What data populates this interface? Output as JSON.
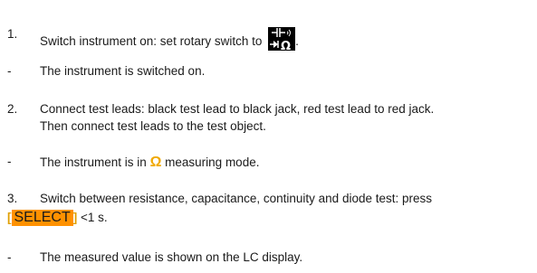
{
  "steps": [
    {
      "marker": "1.",
      "text": "Switch instrument on: set rotary switch to",
      "suffix": "."
    },
    {
      "marker": "-",
      "text": "The instrument is switched on."
    },
    {
      "marker": "2.",
      "line1": "Connect test leads: black test lead to black jack, red test lead to red jack.",
      "line2": "Then connect test leads to the test object."
    },
    {
      "marker": "-",
      "pre": "The instrument is in",
      "symbol": "Ω",
      "post": "measuring mode."
    },
    {
      "marker": "3.",
      "line1": "Switch between resistance, capacitance, continuity and diode test: press",
      "bracket_open": "[",
      "key": "SELECT",
      "bracket_close": "]",
      "after_key": "<1 s."
    },
    {
      "marker": "-",
      "text": "The measured value is shown on the LC display."
    }
  ],
  "switch_symbol": {
    "icon": "rotary-switch-capacitance-diode-continuity-ohm-icon",
    "omega": "Ω"
  },
  "colors": {
    "omega": "#f0a800",
    "key_bg": "#ff9100",
    "symbol_bg": "#000000"
  }
}
